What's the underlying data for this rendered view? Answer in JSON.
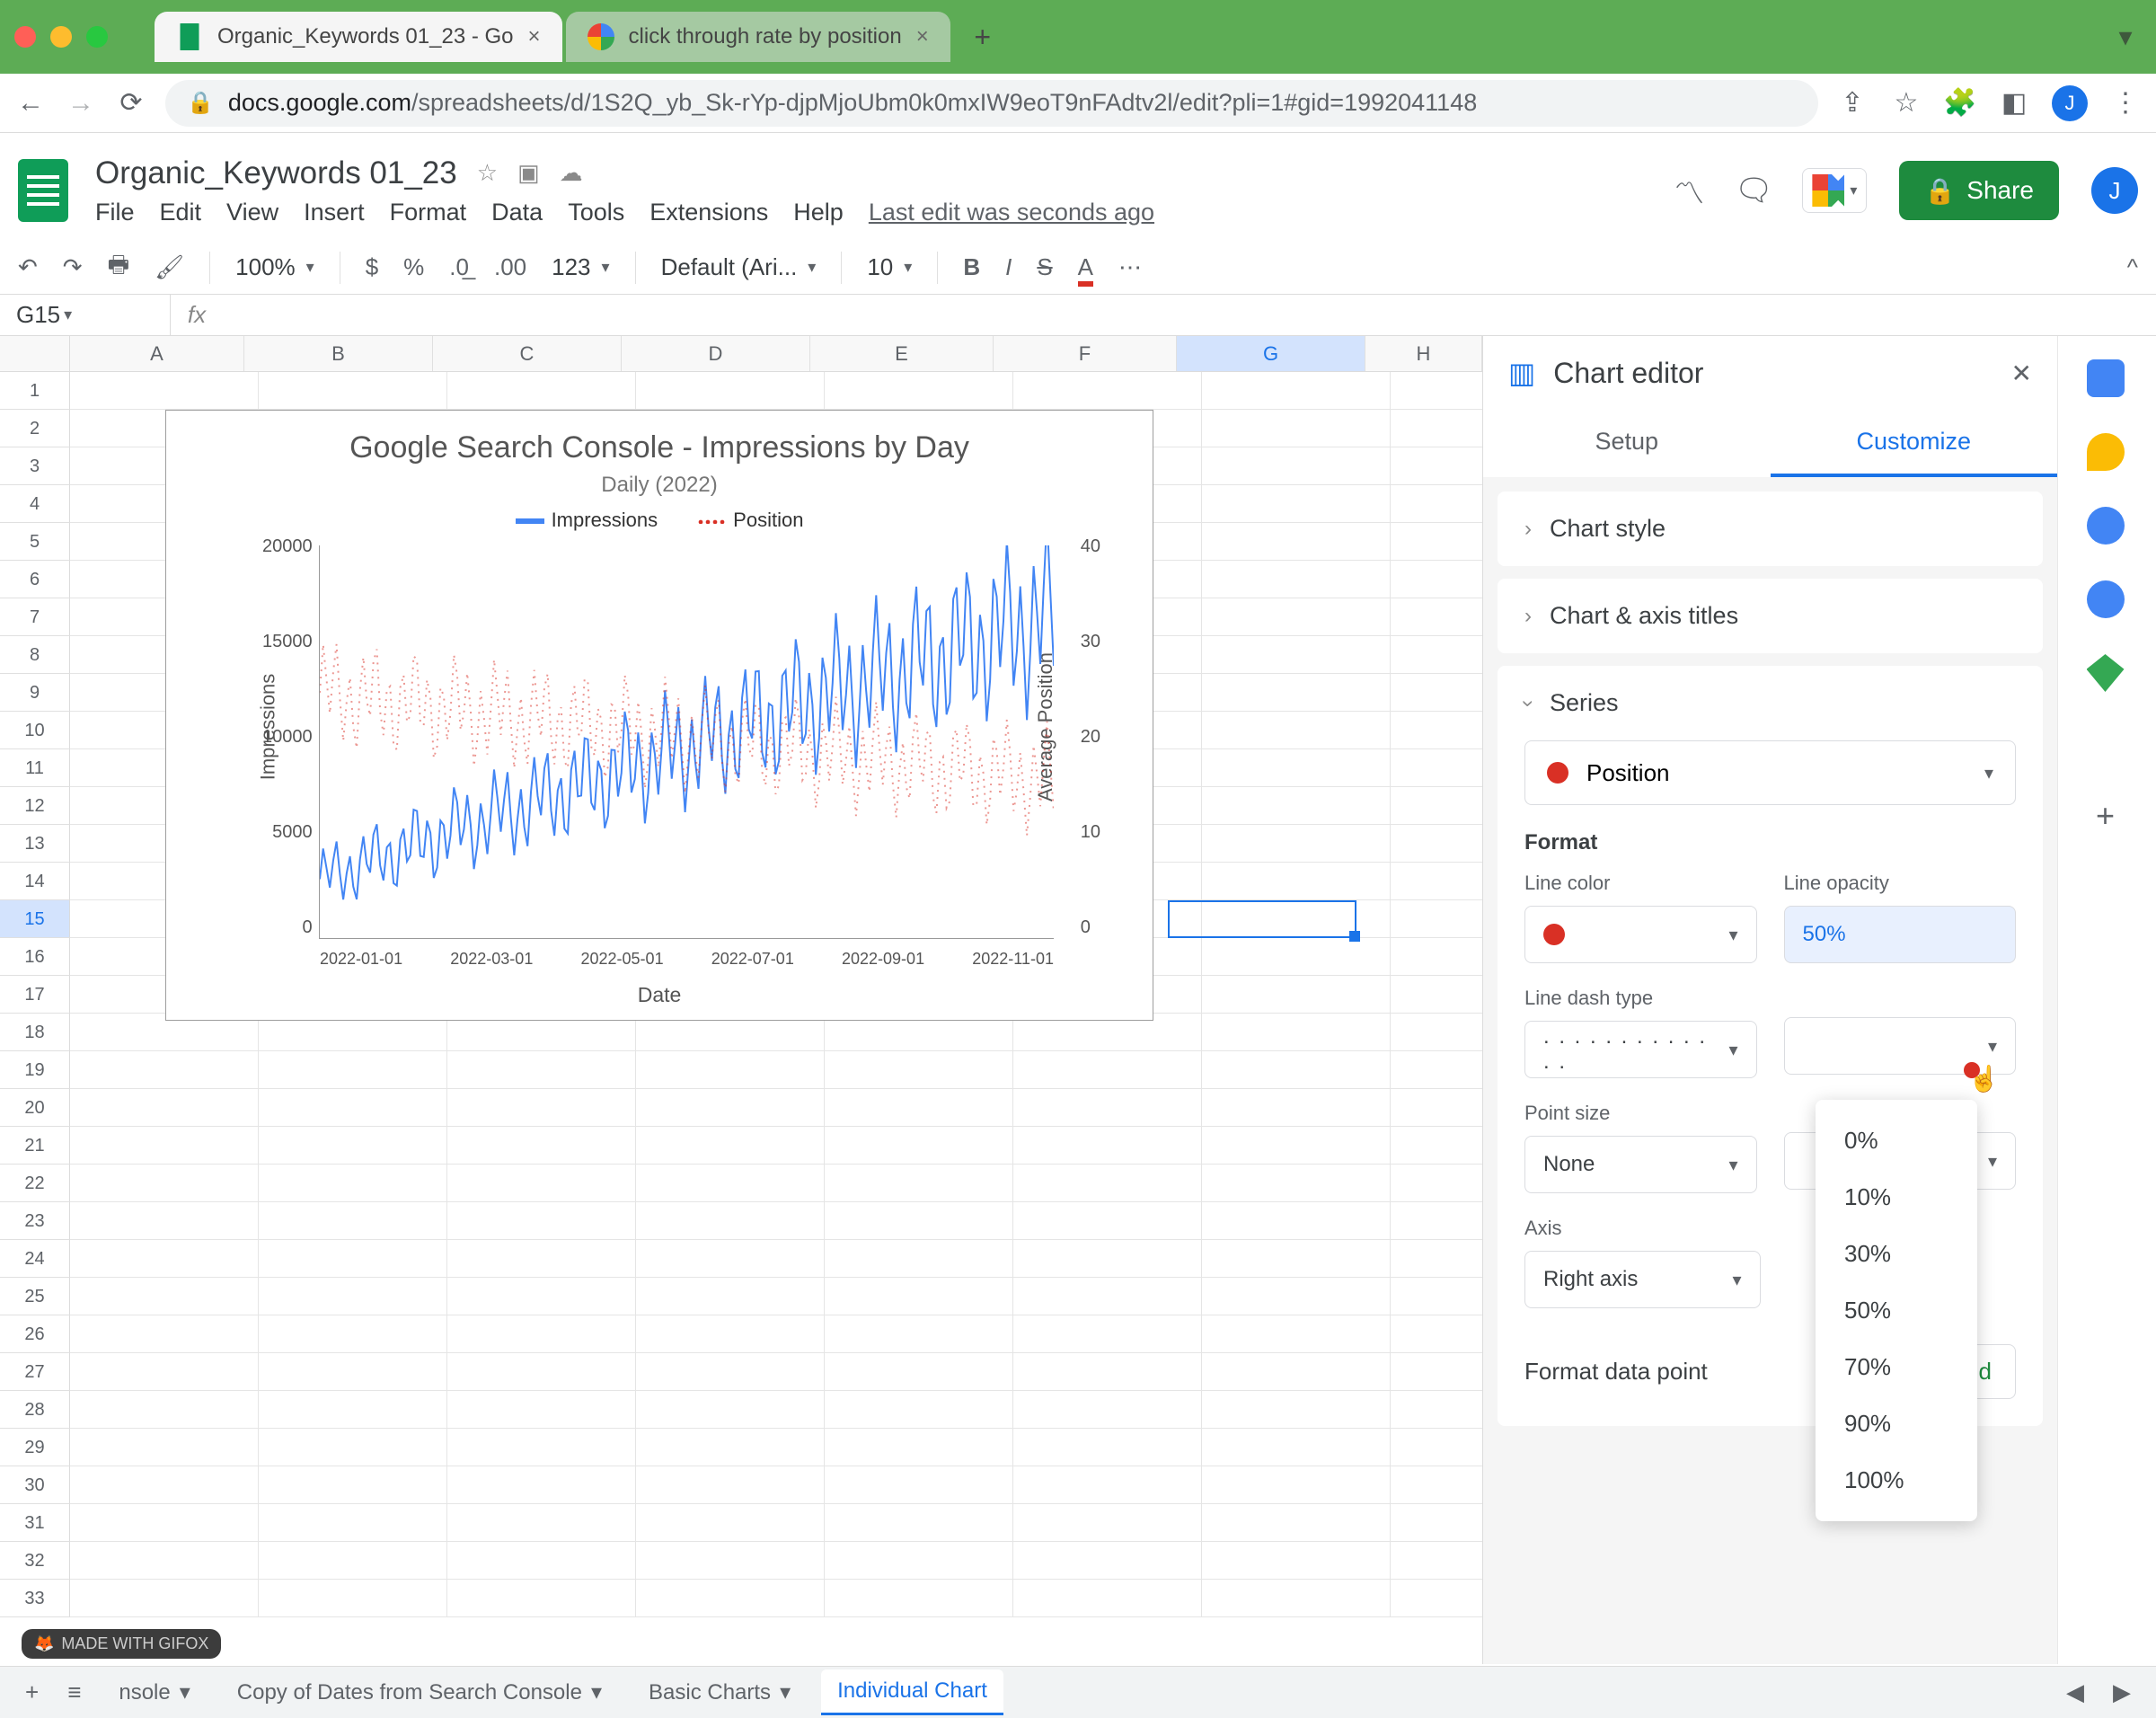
{
  "browser": {
    "tabs": [
      {
        "title": "Organic_Keywords 01_23 - Go",
        "favicon": "sheets"
      },
      {
        "title": "click through rate by position",
        "favicon": "google"
      }
    ],
    "url_host": "docs.google.com",
    "url_path": "/spreadsheets/d/1S2Q_yb_Sk-rYp-djpMjoUbm0k0mxIW9eoT9nFAdtv2l/edit?pli=1#gid=1992041148",
    "avatar_letter": "J"
  },
  "app": {
    "doc_title": "Organic_Keywords 01_23",
    "menus": [
      "File",
      "Edit",
      "View",
      "Insert",
      "Format",
      "Data",
      "Tools",
      "Extensions",
      "Help"
    ],
    "last_edit": "Last edit was seconds ago",
    "share_label": "Share"
  },
  "toolbar": {
    "zoom": "100%",
    "font": "Default (Ari...",
    "font_size": "10",
    "num_fmt": "123"
  },
  "cell_ref": "G15",
  "columns": [
    "A",
    "B",
    "C",
    "D",
    "E",
    "F",
    "G",
    "H"
  ],
  "rows": [
    "1",
    "2",
    "3",
    "4",
    "5",
    "6",
    "7",
    "8",
    "9",
    "10",
    "11",
    "12",
    "13",
    "14",
    "15",
    "16",
    "17",
    "18",
    "19",
    "20",
    "21",
    "22",
    "23",
    "24",
    "25",
    "26",
    "27",
    "28",
    "29",
    "30",
    "31",
    "32",
    "33"
  ],
  "selected_col": "G",
  "selected_row": "15",
  "chart": {
    "title": "Google Search Console - Impressions by Day",
    "subtitle": "Daily (2022)",
    "legend": {
      "impressions": "Impressions",
      "position": "Position"
    },
    "y_left": [
      "20000",
      "15000",
      "10000",
      "5000",
      "0"
    ],
    "y_right": [
      "40",
      "30",
      "20",
      "10",
      "0"
    ],
    "x_ticks": [
      "2022-01-01",
      "2022-03-01",
      "2022-05-01",
      "2022-07-01",
      "2022-09-01",
      "2022-11-01"
    ],
    "y_left_label": "Impressions",
    "y_right_label": "Average Position",
    "x_label": "Date"
  },
  "editor": {
    "title": "Chart editor",
    "tabs": {
      "setup": "Setup",
      "customize": "Customize"
    },
    "sections": {
      "style": "Chart style",
      "axis_titles": "Chart & axis titles",
      "series": "Series"
    },
    "series_selected": "Position",
    "format_header": "Format",
    "labels": {
      "line_color": "Line color",
      "line_opacity": "Line opacity",
      "line_dash": "Line dash type",
      "point_size": "Point size",
      "axis": "Axis",
      "format_dp": "Format data point",
      "add": "Add"
    },
    "values": {
      "opacity": "50%",
      "point_size": "None",
      "axis": "Right axis",
      "dash_preview": ". . . . . . . . . . . . ."
    },
    "opacity_options": [
      "0%",
      "10%",
      "30%",
      "50%",
      "70%",
      "90%",
      "100%"
    ]
  },
  "sheet_tabs": {
    "left_cut": "nsole",
    "copy": "Copy of Dates from Search Console",
    "basic": "Basic Charts",
    "individual": "Individual Chart"
  },
  "gifox": "MADE WITH GIFOX",
  "chart_data": {
    "type": "line",
    "title": "Google Search Console - Impressions by Day",
    "subtitle": "Daily (2022)",
    "xlabel": "Date",
    "y_left": {
      "label": "Impressions",
      "lim": [
        0,
        20000
      ],
      "ticks": [
        0,
        5000,
        10000,
        15000,
        20000
      ]
    },
    "y_right": {
      "label": "Average Position",
      "lim": [
        0,
        40
      ],
      "ticks": [
        0,
        10,
        20,
        30,
        40
      ]
    },
    "x_ticks": [
      "2022-01-01",
      "2022-03-01",
      "2022-05-01",
      "2022-07-01",
      "2022-09-01",
      "2022-11-01"
    ],
    "series": [
      {
        "name": "Impressions",
        "axis": "left",
        "color": "#4285f4",
        "style": "solid",
        "approx_monthly_mean": [
          3000,
          4500,
          6000,
          7500,
          9000,
          10500,
          11500,
          12500,
          13500,
          14500,
          15500,
          16500
        ],
        "pattern": "oscillating daily values around an upward trend, peaks ~4000 above monthly mean, troughs ~3000 below"
      },
      {
        "name": "Position",
        "axis": "right",
        "color": "#d93025",
        "style": "dotted",
        "opacity": 0.5,
        "approx_monthly_mean": [
          25,
          24,
          23,
          22,
          22,
          21,
          20,
          19,
          19,
          18,
          17,
          16
        ],
        "pattern": "noisy around slightly decreasing mean, bounded roughly 15-30"
      }
    ]
  }
}
